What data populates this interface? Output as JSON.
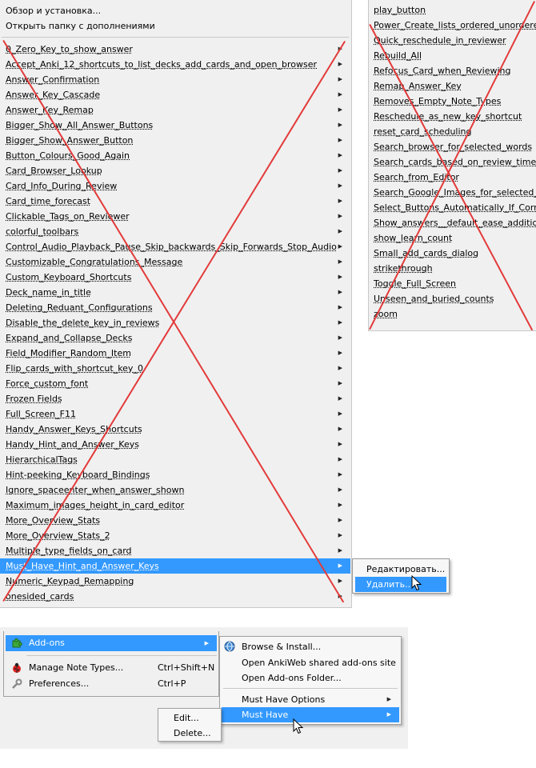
{
  "left_menu": {
    "top_items": [
      "Обзор и установка...",
      "Открыть папку с дополнениями"
    ],
    "items": [
      "0_Zero_Key_to_show_answer",
      "Accept_Anki_12_shortcuts_to_list_decks_add_cards_and_open_browser",
      "Answer_Confirmation",
      "Answer_Key_Cascade",
      "Answer_Key_Remap",
      "Bigger_Show_All_Answer_Buttons",
      "Bigger_Show_Answer_Button",
      "Button_Colours_Good_Again",
      "Card_Browser_Lookup",
      "Card_Info_During_Review",
      "Card_time_forecast",
      "Clickable_Tags_on_Reviewer",
      "colorful_toolbars",
      "Control_Audio_Playback_Pause_Skip_backwards_Skip_Forwards_Stop_Audio",
      "Customizable_Congratulations_Message",
      "Custom_Keyboard_Shortcuts",
      "Deck_name_in_title",
      "Deleting_Reduant_Configurations",
      "Disable_the_delete_key_in_reviews",
      "Expand_and_Collapse_Decks",
      "Field_Modifier_Random_Item",
      "Flip_cards_with_shortcut_key_0",
      "Force_custom_font",
      "Frozen Fields",
      "Full_Screen_F11",
      "Handy_Answer_Keys_Shortcuts",
      "Handy_Hint_and_Answer_Keys",
      "HierarchicalTags",
      "Hint-peeking_Keyboard_Bindings",
      "Ignore_spaceenter_when_answer_shown",
      "Maximum_images_height_in_card_editor",
      "More_Overview_Stats",
      "More_Overview_Stats_2",
      "Multiple_type_fields_on_card",
      "Must_Have_Hint_and_Answer_Keys",
      "Numeric_Keypad_Remapping",
      "onesided_cards"
    ],
    "highlighted_index": 34
  },
  "right_menu": {
    "items": [
      "play_button",
      "Power_Create_lists_ordered_unordered_",
      "Quick_reschedule_in_reviewer",
      "Rebuild_All",
      "Refocus_Card_when_Reviewing",
      "Remap_Answer_Key",
      "Removes_Empty_Note_Types",
      "Reschedule_as_new_key_shortcut",
      "reset_card_scheduling",
      "Search_browser_for_selected_words",
      "Search_cards_based_on_review_time",
      "Search_from_Editor",
      "Search_Google_Images_for_selected_w",
      "Select_Buttons_Automatically_If_Corre",
      "Show_answers__default_ease_additiona",
      "show_learn_count",
      "Small_add_cards_dialog",
      "strikethrough",
      "Toggle_Full_Screen",
      "Unseen_and_buried_counts",
      "zoom"
    ]
  },
  "context_submenu": {
    "items": [
      "Редактировать...",
      "Удалить..."
    ],
    "highlighted_index": 1
  },
  "tools_menu": {
    "items": [
      {
        "label": "Add-ons",
        "shortcut": "",
        "icon": "puzzle-icon",
        "has_submenu": true
      },
      {
        "label": "Manage Note Types...",
        "shortcut": "Ctrl+Shift+N",
        "icon": "ladybug-icon",
        "has_submenu": false
      },
      {
        "label": "Preferences...",
        "shortcut": "Ctrl+P",
        "icon": "wrench-icon",
        "has_submenu": false
      }
    ]
  },
  "addons_submenu": {
    "items": [
      {
        "label": "Browse & Install...",
        "icon": "globe-icon",
        "has_submenu": false
      },
      {
        "label": "Open AnkiWeb shared add-ons site",
        "icon": "",
        "has_submenu": false
      },
      {
        "label": "Open Add-ons Folder...",
        "icon": "",
        "has_submenu": false
      },
      {
        "label": "Must Have Options",
        "icon": "",
        "has_submenu": true
      },
      {
        "label": "Must Have",
        "icon": "",
        "has_submenu": true
      }
    ],
    "highlighted_index": 4
  },
  "edit_delete_menu": {
    "items": [
      "Edit...",
      "Delete..."
    ]
  },
  "colors": {
    "highlight": "#3399ff",
    "menu_bg": "#f0f0f0",
    "cross": "#e33a3a"
  }
}
